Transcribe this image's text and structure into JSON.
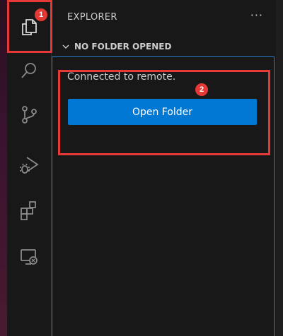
{
  "sidebar": {
    "title": "EXPLORER",
    "more_label": "···",
    "section_title": "NO FOLDER OPENED",
    "connected_text": "Connected to remote.",
    "open_folder_label": "Open Folder"
  },
  "activity_bar": {
    "icons": [
      "explorer-icon",
      "search-icon",
      "source-control-icon",
      "run-debug-icon",
      "extensions-icon",
      "remote-explorer-icon"
    ],
    "active": "explorer-icon"
  },
  "annotations": [
    "1",
    "2"
  ],
  "colors": {
    "accent": "#0078d4",
    "annotation": "#e53935",
    "background": "#181818"
  }
}
